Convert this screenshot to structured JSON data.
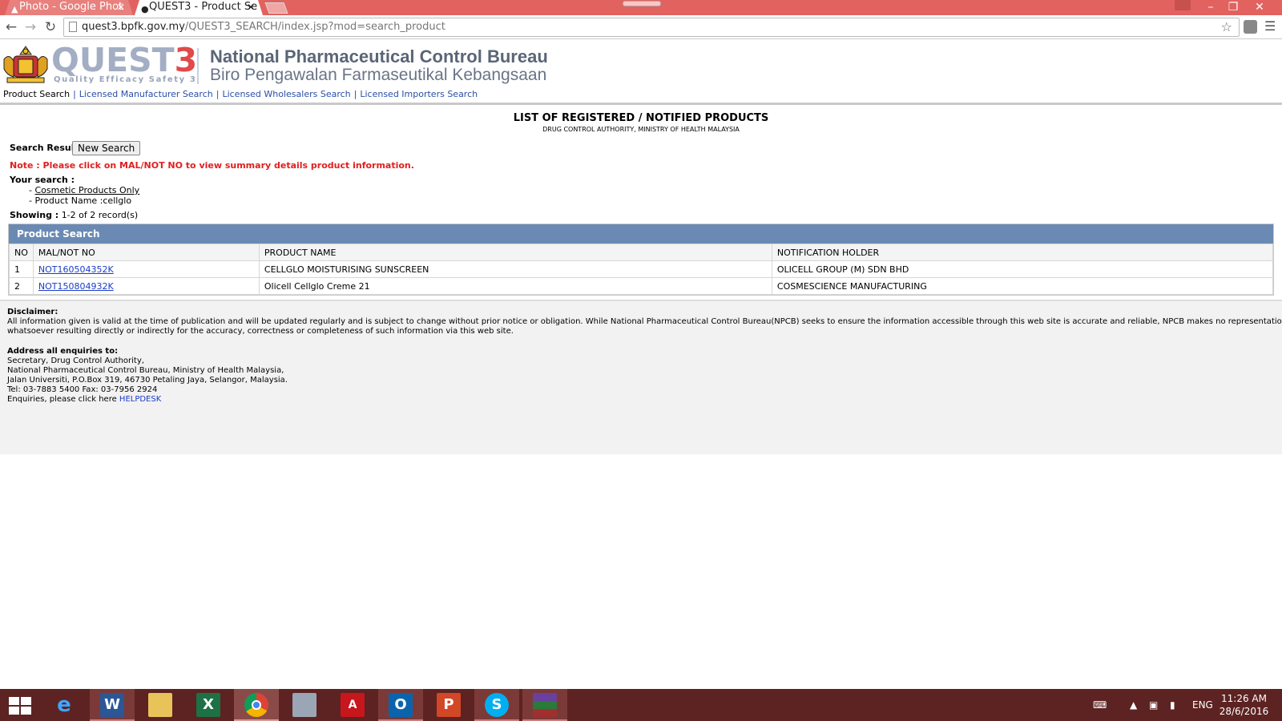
{
  "browser": {
    "tabs": [
      {
        "label": "Photo - Google Phot",
        "active": false
      },
      {
        "label": "QUEST3 - Product Se",
        "active": true
      }
    ],
    "url_domain": "quest3.bpfk.gov.my",
    "url_path": "/QUEST3_SEARCH/index.jsp?mod=search_product"
  },
  "header": {
    "logo_text": "QUEST",
    "logo_number": "3",
    "tagline": "Quality Efficacy Safety 3",
    "org_en": "National Pharmaceutical Control Bureau",
    "org_my": "Biro Pengawalan Farmaseutikal Kebangsaan",
    "nav": {
      "current": "Product Search",
      "links": [
        "Licensed Manufacturer Search",
        "Licensed Wholesalers Search",
        "Licensed Importers Search"
      ]
    }
  },
  "main": {
    "title": "LIST OF REGISTERED / NOTIFIED PRODUCTS",
    "subtitle": "DRUG CONTROL AUTHORITY, MINISTRY OF HEALTH MALAYSIA",
    "search_result_label": "Search Result",
    "new_search_button": "New Search",
    "note": "Note : Please click on MAL/NOT NO to view summary details product information.",
    "your_search_label": "Your search :",
    "search_criteria_1": "Cosmetic Products Only",
    "search_criteria_2": "- Product Name :cellglo",
    "showing_label": "Showing :",
    "showing_value": "1-2 of 2 record(s)",
    "table": {
      "heading": "Product Search",
      "columns": [
        "NO",
        "MAL/NOT NO",
        "PRODUCT NAME",
        "NOTIFICATION HOLDER"
      ],
      "rows": [
        {
          "no": "1",
          "mal": "NOT160504352K",
          "name": "CELLGLO MOISTURISING SUNSCREEN",
          "holder": "OLICELL GROUP (M) SDN BHD"
        },
        {
          "no": "2",
          "mal": "NOT150804932K",
          "name": "Olicell Cellglo Creme 21",
          "holder": "COSMESCIENCE MANUFACTURING"
        }
      ]
    }
  },
  "footer": {
    "disclaimer_label": "Disclaimer:",
    "disclaimer_line1": "All information given is valid at the time of publication and will be updated regularly and is subject to change without prior notice or obligation. While National Pharmaceutical Control Bureau(NPCB) seeks to ensure the information accessible through this web site is accurate and reliable, NPCB makes no representation",
    "disclaimer_line2": "whatsoever resulting directly or indirectly for the accuracy, correctness or completeness of such information via this web site.",
    "address_label": "Address all enquiries to:",
    "address_lines": [
      "Secretary, Drug Control Authority,",
      "National Pharmaceutical Control Bureau, Ministry of Health Malaysia,",
      "Jalan Universiti, P.O.Box 319, 46730 Petaling Jaya, Selangor, Malaysia.",
      "Tel: 03-7883 5400 Fax: 03-7956 2924"
    ],
    "enquiries_text": "Enquiries, please click here",
    "helpdesk_link": "HELPDESK"
  },
  "taskbar": {
    "apps": [
      "windows-start",
      "internet-explorer",
      "word",
      "file-explorer",
      "excel",
      "chrome",
      "calculator",
      "acrobat",
      "outlook",
      "powerpoint",
      "skype",
      "winrar"
    ],
    "language": "ENG",
    "time": "11:26 AM",
    "date": "28/6/2016"
  },
  "colors": {
    "chrome_frame": "#e2625f",
    "table_header": "#6a8ab4",
    "note_red": "#e02020",
    "taskbar": "#5c2322"
  }
}
